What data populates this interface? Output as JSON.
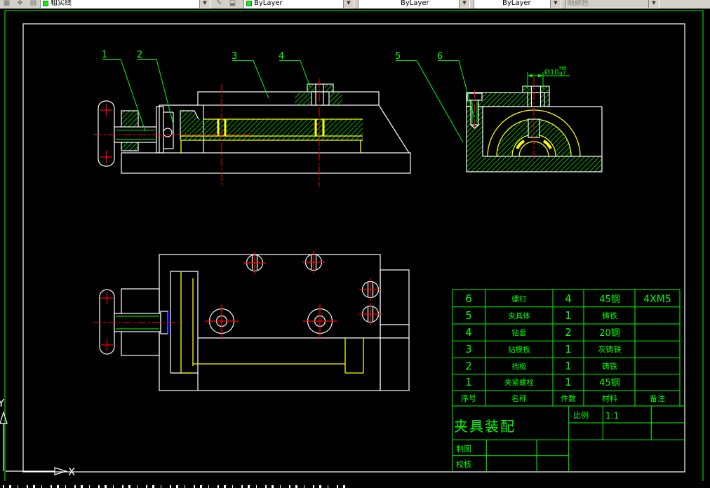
{
  "toolbar": {
    "icons": {
      "layer_manager": "▦",
      "layer_states": "❖",
      "layer_list": "▤",
      "make_layer_current": "✎",
      "layer_previous": "⬓"
    },
    "layer": {
      "value": "粗实线",
      "swatch_color": "#00ff00"
    },
    "color": {
      "value": "ByLayer",
      "swatch_color": "#00ff00"
    },
    "linetype": {
      "value": "ByLayer"
    },
    "lineweight": {
      "value": "ByLayer"
    },
    "plot_style": {
      "value": "随颜色",
      "disabled": true
    }
  },
  "drawing": {
    "callouts": [
      "1",
      "2",
      "3",
      "4",
      "5",
      "6"
    ],
    "dimension": {
      "text": "Ø10",
      "fit_upper": "H6",
      "fit_lower": "g7"
    },
    "ucs": {
      "x_label": "X",
      "y_label": "Y"
    }
  },
  "bom": {
    "headers": {
      "no": "序号",
      "name": "名称",
      "qty": "件数",
      "material": "材料",
      "remarks": "备注"
    },
    "rows": [
      {
        "no": "6",
        "name": "螺钉",
        "qty": "4",
        "material": "45钢",
        "remarks": "4XM5"
      },
      {
        "no": "5",
        "name": "夹具体",
        "qty": "1",
        "material": "铸铁",
        "remarks": ""
      },
      {
        "no": "4",
        "name": "钻套",
        "qty": "2",
        "material": "20钢",
        "remarks": ""
      },
      {
        "no": "3",
        "name": "钻模板",
        "qty": "1",
        "material": "灰铸铁",
        "remarks": ""
      },
      {
        "no": "2",
        "name": "挡板",
        "qty": "1",
        "material": "铸铁",
        "remarks": ""
      },
      {
        "no": "1",
        "name": "夹紧螺栓",
        "qty": "1",
        "material": "45钢",
        "remarks": ""
      }
    ]
  },
  "title_block": {
    "title": "夹具装配",
    "scale_label": "比例",
    "scale_value": "1:1",
    "drawn_label": "制图",
    "checked_label": "校核"
  },
  "colors": {
    "annotation_green": "#00ff00",
    "hatch_green": "#00b800",
    "geometry_white": "#ffffff",
    "workpiece_yellow": "#ffff00",
    "centerline_red": "#ff0000",
    "detail_blue": "#0000ff",
    "toolbar_bg": "#d4d0c8"
  }
}
